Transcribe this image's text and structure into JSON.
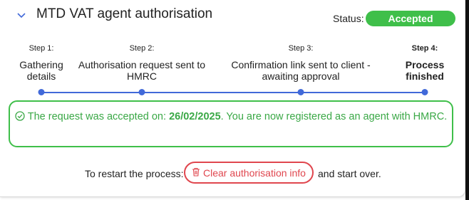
{
  "header": {
    "title": "MTD VAT agent authorisation",
    "status_label": "Status:",
    "status_value": "Accepted"
  },
  "steps": [
    {
      "number": "Step 1:",
      "text": "Gathering details"
    },
    {
      "number": "Step 2:",
      "text": "Authorisation request sent to HMRC"
    },
    {
      "number": "Step 3:",
      "text": "Confirmation link sent to client - awaiting approval"
    },
    {
      "number": "Step 4:",
      "text": "Process finished"
    }
  ],
  "message": {
    "prefix": "The request was accepted on: ",
    "date": "26/02/2025",
    "suffix": ". You are now registered as an agent with HMRC."
  },
  "restart": {
    "before": "To restart the process:",
    "button_label": "Clear authorisation info",
    "after": "and start over."
  },
  "colors": {
    "accent_blue": "#4169d9",
    "success_green": "#3fbf4a",
    "danger_red": "#e0464e"
  },
  "icons": {
    "header_toggle": "chevron-down-icon",
    "message": "check-circle-icon",
    "clear": "trash-icon"
  }
}
